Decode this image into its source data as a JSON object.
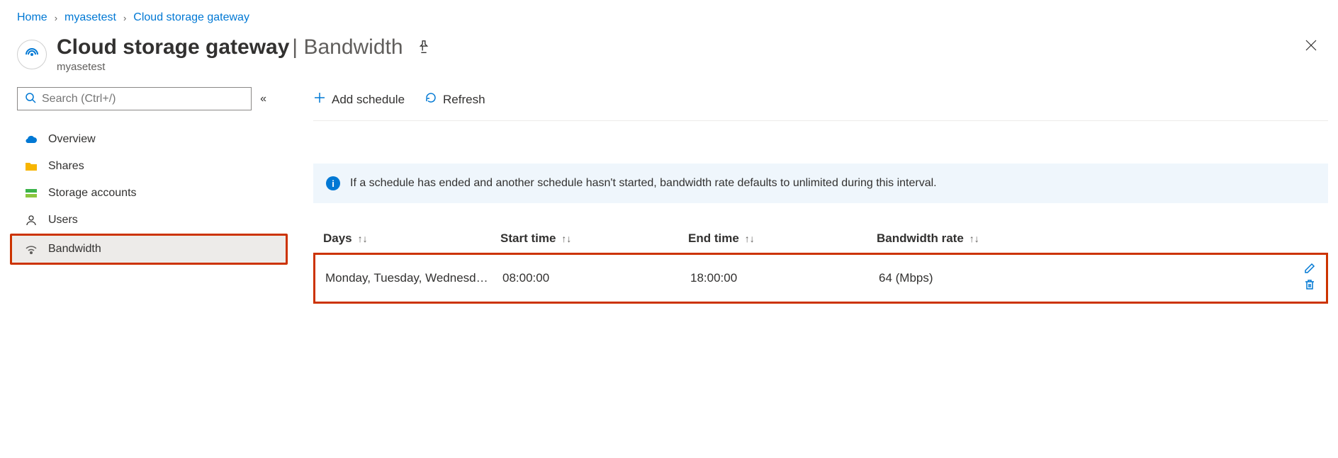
{
  "breadcrumb": {
    "home": "Home",
    "resource": "myasetest",
    "page": "Cloud storage gateway"
  },
  "header": {
    "title": "Cloud storage gateway",
    "section": "Bandwidth",
    "subtitle": "myasetest",
    "separator": "|"
  },
  "search": {
    "placeholder": "Search (Ctrl+/)"
  },
  "nav": {
    "overview": "Overview",
    "shares": "Shares",
    "storage": "Storage accounts",
    "users": "Users",
    "bandwidth": "Bandwidth"
  },
  "toolbar": {
    "add": "Add schedule",
    "refresh": "Refresh"
  },
  "info": {
    "text": "If a schedule has ended and another schedule hasn't started, bandwidth rate defaults to unlimited during this interval."
  },
  "table": {
    "headers": {
      "days": "Days",
      "start": "Start time",
      "end": "End time",
      "rate": "Bandwidth rate"
    },
    "rows": [
      {
        "days": "Monday, Tuesday, Wednesd…",
        "start": "08:00:00",
        "end": "18:00:00",
        "rate": "64 (Mbps)"
      }
    ]
  }
}
